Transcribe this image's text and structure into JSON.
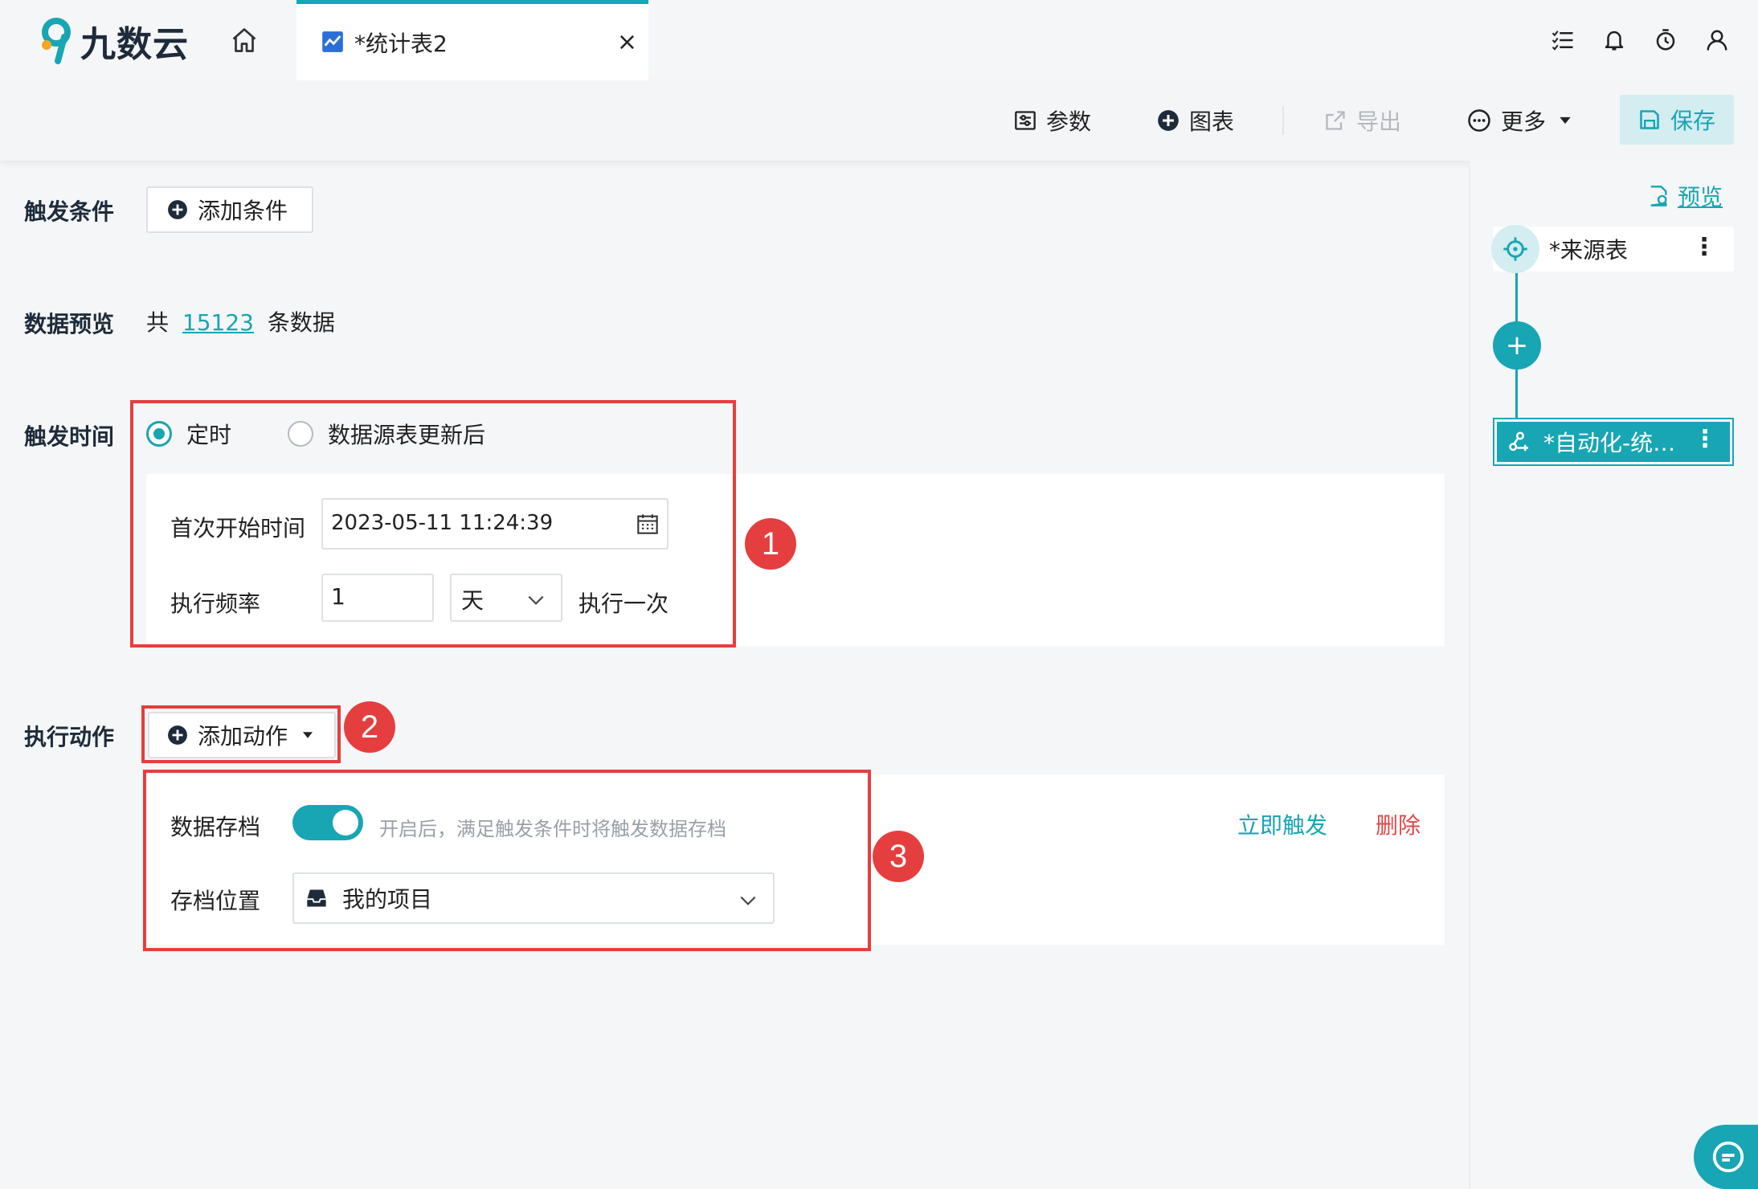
{
  "app": {
    "logo_text": "九数云"
  },
  "tab": {
    "label": "*统计表2",
    "close": "×"
  },
  "toolbar": {
    "params": "参数",
    "chart": "图表",
    "export": "导出",
    "more": "更多",
    "save": "保存"
  },
  "trigger_condition": {
    "label": "触发条件",
    "add_button": "添加条件"
  },
  "data_preview": {
    "label": "数据预览",
    "prefix": "共",
    "count": "15123",
    "suffix": "条数据"
  },
  "trigger_time": {
    "label": "触发时间",
    "options": [
      "定时",
      "数据源表更新后"
    ],
    "selected": "定时",
    "first_start_label": "首次开始时间",
    "first_start_value": "2023-05-11 11:24:39",
    "frequency_label": "执行频率",
    "frequency_value": "1",
    "frequency_unit": "天",
    "frequency_suffix": "执行一次"
  },
  "action": {
    "label": "执行动作",
    "add_button": "添加动作",
    "archive_label": "数据存档",
    "archive_enabled": true,
    "archive_hint": "开启后，满足触发条件时将触发数据存档",
    "trigger_now": "立即触发",
    "delete": "删除",
    "location_label": "存档位置",
    "location_value": "我的项目"
  },
  "annotations": {
    "badge1": "1",
    "badge2": "2",
    "badge3": "3"
  },
  "right_panel": {
    "preview": "预览",
    "source_node": "*来源表",
    "add_node": "+",
    "auto_node": "*自动化-统…",
    "more": "⋮"
  },
  "colors": {
    "accent": "#18a5b4",
    "danger": "#e53e3e",
    "delete": "#e04848"
  }
}
